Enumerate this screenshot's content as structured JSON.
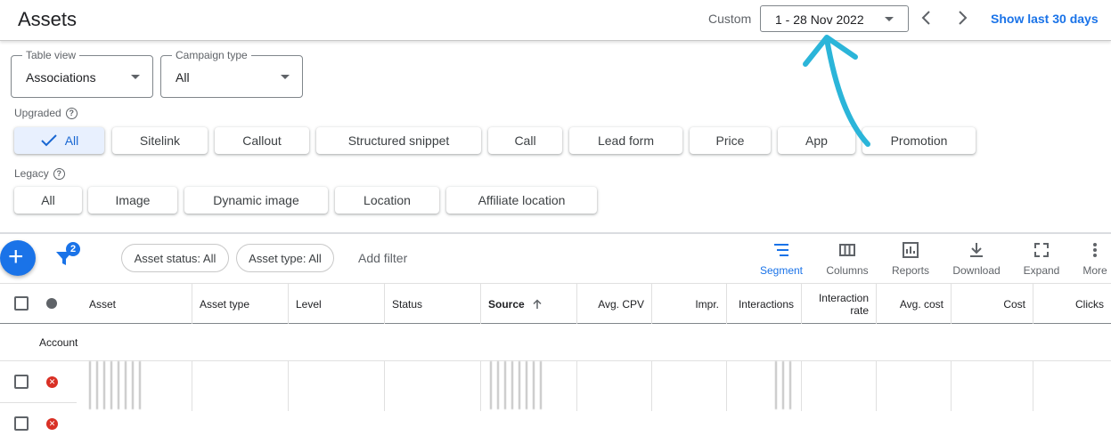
{
  "header": {
    "title": "Assets",
    "date_label": "Custom",
    "date_value": "1 - 28 Nov 2022",
    "show_last": "Show last 30 days"
  },
  "filters": {
    "table_view": {
      "label": "Table view",
      "value": "Associations"
    },
    "campaign_type": {
      "label": "Campaign type",
      "value": "All"
    }
  },
  "upgraded": {
    "label": "Upgraded",
    "chips": [
      "All",
      "Sitelink",
      "Callout",
      "Structured snippet",
      "Call",
      "Lead form",
      "Price",
      "App",
      "Promotion"
    ],
    "selected": "All"
  },
  "legacy": {
    "label": "Legacy",
    "chips": [
      "All",
      "Image",
      "Dynamic image",
      "Location",
      "Affiliate location"
    ]
  },
  "toolbar": {
    "filter_count": "2",
    "filter_chips": [
      "Asset status: All",
      "Asset type: All"
    ],
    "add_filter": "Add filter",
    "tools": [
      "Segment",
      "Columns",
      "Reports",
      "Download",
      "Expand",
      "More"
    ]
  },
  "table": {
    "headers": [
      "Asset",
      "Asset type",
      "Level",
      "Status",
      "Source",
      "Avg. CPV",
      "Impr.",
      "Interactions",
      "Interaction rate",
      "Avg. cost",
      "Cost",
      "Clicks"
    ],
    "group_row": "Account"
  },
  "colors": {
    "accent": "#1a73e8",
    "annotation_arrow": "#2bb5d9",
    "error": "#d93025"
  }
}
